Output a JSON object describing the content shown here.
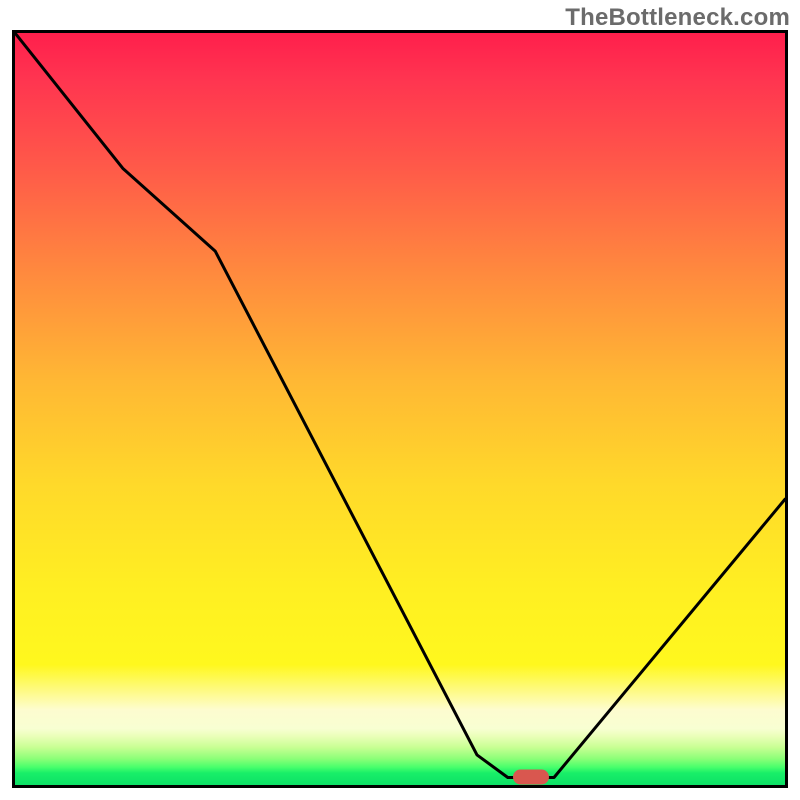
{
  "watermark": "TheBottleneck.com",
  "colors": {
    "frame_border": "#000000",
    "curve_stroke": "#000000",
    "marker_fill": "#d9574f",
    "gradient_top": "#ff1f4c",
    "gradient_mid": "#ffd92a",
    "gradient_bottom": "#0de066"
  },
  "chart_data": {
    "type": "line",
    "title": "",
    "xlabel": "",
    "ylabel": "",
    "xlim": [
      0,
      100
    ],
    "ylim": [
      0,
      100
    ],
    "notes": "Background is a vertical gradient implying bottleneck severity (red = bad at top, green = good at bottom). Curve is a V-shaped black line whose minimum (near the green band) indicates the balanced/no-bottleneck point. A small rounded red marker sits on the flat minimum. No numeric axes or tick labels are rendered.",
    "series": [
      {
        "name": "bottleneck-curve",
        "points": [
          {
            "x": 0,
            "y": 100
          },
          {
            "x": 14,
            "y": 82
          },
          {
            "x": 26,
            "y": 71
          },
          {
            "x": 60,
            "y": 4
          },
          {
            "x": 64,
            "y": 1
          },
          {
            "x": 70,
            "y": 1
          },
          {
            "x": 100,
            "y": 38
          }
        ]
      }
    ],
    "marker": {
      "x": 67,
      "y": 1
    },
    "grid": false,
    "legend": false
  }
}
